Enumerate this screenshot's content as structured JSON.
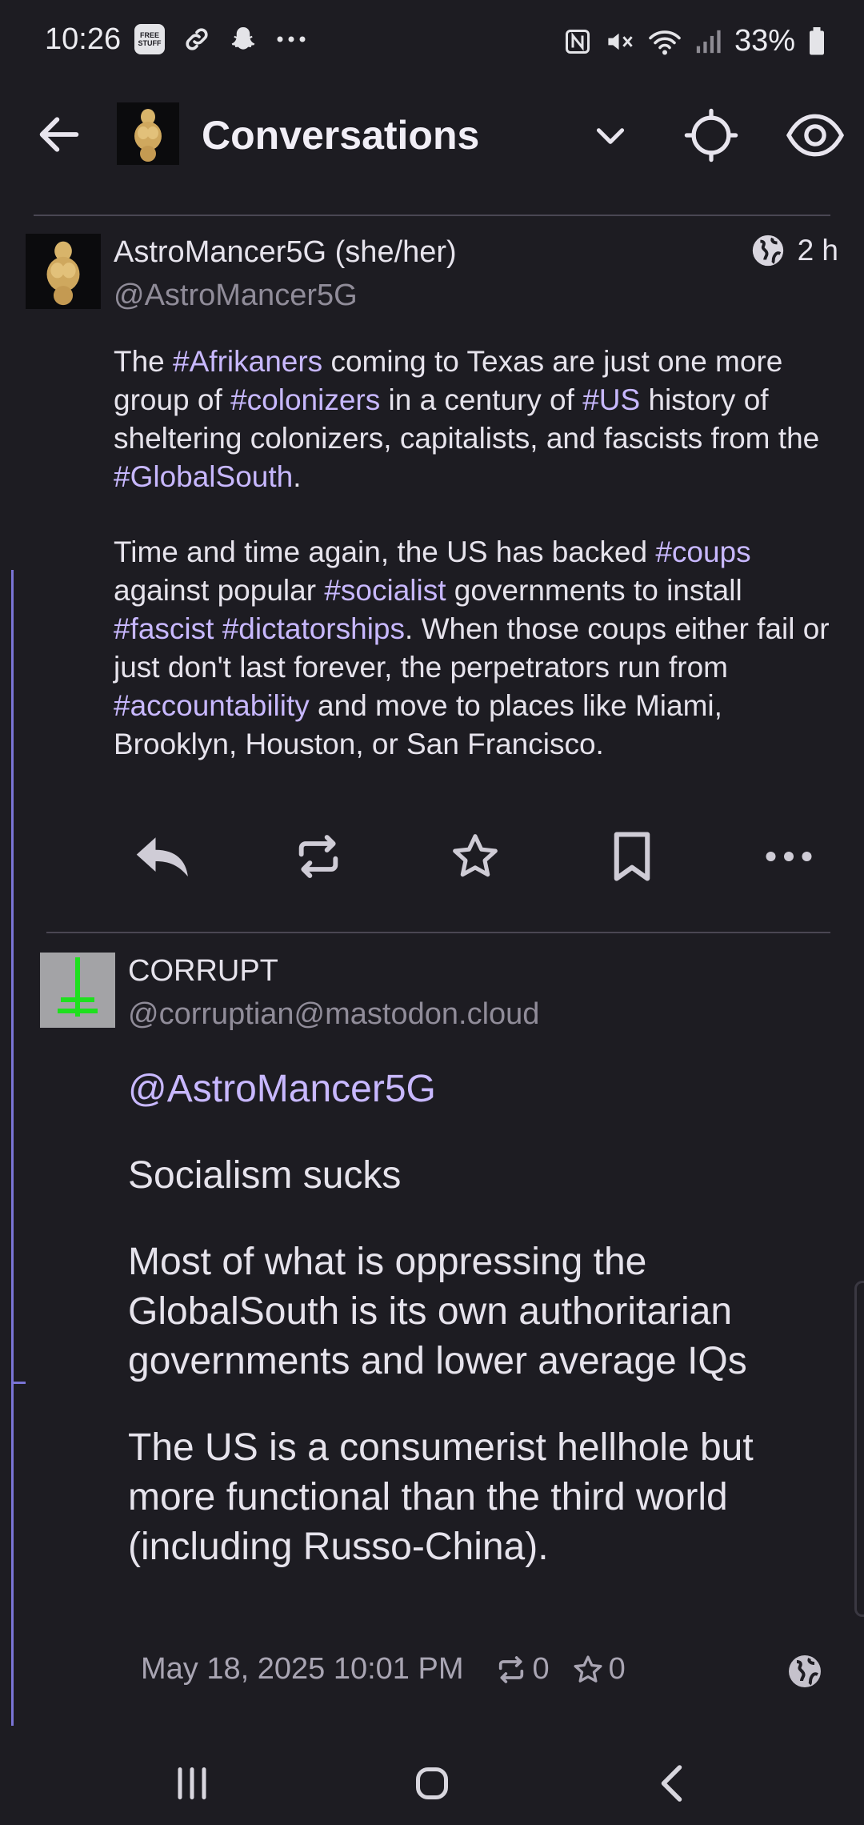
{
  "status_bar": {
    "time": "10:26",
    "badge_text": "FREE STUFF",
    "battery_pct": "33%"
  },
  "app_bar": {
    "title": "Conversations"
  },
  "post": {
    "display_name": "AstroMancer5G (she/her)",
    "handle": "@AstroMancer5G",
    "age": "2 h",
    "para1": [
      {
        "t": "The "
      },
      {
        "t": "#Afrikaners",
        "tag": true
      },
      {
        "t": " coming to Texas are just one more group of "
      },
      {
        "t": "#colonizers",
        "tag": true
      },
      {
        "t": " in a century of "
      },
      {
        "t": "#US",
        "tag": true
      },
      {
        "t": " history of sheltering colonizers, capitalists, and fascists from the "
      },
      {
        "t": "#GlobalSouth",
        "tag": true
      },
      {
        "t": "."
      }
    ],
    "para2": [
      {
        "t": "Time and time again, the US has backed "
      },
      {
        "t": "#coups",
        "tag": true
      },
      {
        "t": " against popular "
      },
      {
        "t": "#socialist",
        "tag": true
      },
      {
        "t": " governments to install "
      },
      {
        "t": "#fascist",
        "tag": true
      },
      {
        "t": " "
      },
      {
        "t": "#dictatorships",
        "tag": true
      },
      {
        "t": ". When those coups either fail or just don't last forever, the perpetrators run from "
      },
      {
        "t": "#accountability",
        "tag": true
      },
      {
        "t": " and move to places like Miami, Brooklyn, Houston, or San Francisco."
      }
    ]
  },
  "reply": {
    "display_name": "CORRUPT",
    "handle": "@corruptian@mastodon.cloud",
    "mention": "@AstroMancer5G",
    "para1": "Socialism sucks",
    "para2": "Most of what is oppressing the GlobalSouth is its own authoritarian governments and lower average IQs",
    "para3": "The US is a consumerist hellhole but more functional than the third world (including Russo-China).",
    "timestamp": "May 18, 2025 10:01 PM",
    "boosts": "0",
    "favourites": "0"
  },
  "colors": {
    "background": "#1d1c22",
    "hashtag": "#c8b8ff",
    "thread_line": "#7a74d6",
    "secondary_text": "#908c99"
  },
  "icons": [
    "back-arrow-icon",
    "chevron-down-icon",
    "crosshair-icon",
    "eye-icon",
    "globe-icon",
    "reply-icon",
    "boost-icon",
    "star-icon",
    "bookmark-icon",
    "more-icon"
  ]
}
